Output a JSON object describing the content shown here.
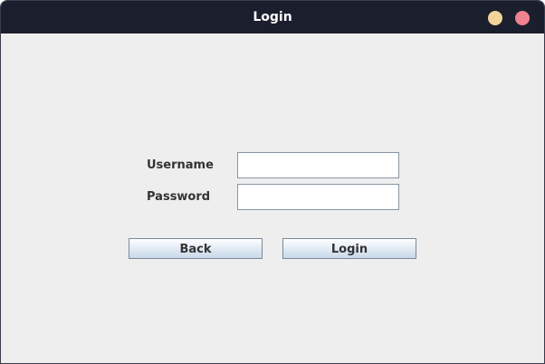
{
  "window": {
    "title": "Login",
    "minimize_color": "#f2d49b",
    "close_color": "#ef8190"
  },
  "form": {
    "username_label": "Username",
    "username_value": "",
    "password_label": "Password",
    "password_value": ""
  },
  "buttons": {
    "back_label": "Back",
    "login_label": "Login"
  },
  "icons": {
    "minimize": "minimize-circle-icon",
    "close": "close-circle-icon"
  }
}
